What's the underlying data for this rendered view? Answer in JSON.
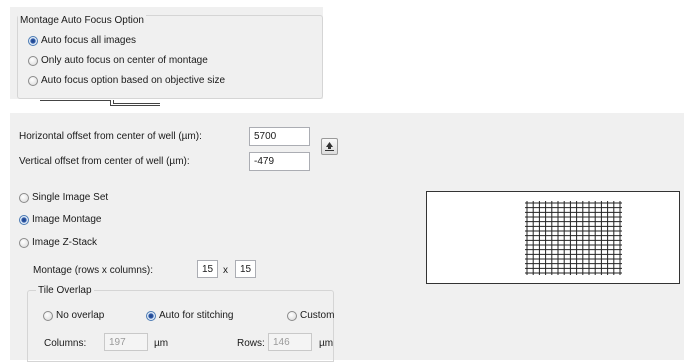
{
  "montage_af": {
    "title": "Montage Auto Focus Option",
    "options": [
      {
        "label": "Auto focus all images",
        "selected": true
      },
      {
        "label": "Only auto focus on center of montage",
        "selected": false
      },
      {
        "label": "Auto focus option based on objective size",
        "selected": false
      }
    ]
  },
  "offsets": {
    "horizontal_label": "Horizontal offset from center of well (µm):",
    "horizontal_value": "5700",
    "vertical_label": "Vertical offset from center of well (µm):",
    "vertical_value": "-479",
    "up_button_icon": "arrow-up-icon"
  },
  "acquisition": {
    "options": [
      {
        "label": "Single Image Set",
        "selected": false
      },
      {
        "label": "Image Montage",
        "selected": true
      },
      {
        "label": "Image Z-Stack",
        "selected": false
      }
    ]
  },
  "montage": {
    "label": "Montage (rows x columns):",
    "rows": "15",
    "separator": "x",
    "columns": "15"
  },
  "tile_overlap": {
    "title": "Tile Overlap",
    "options": [
      {
        "label": "No overlap",
        "selected": false
      },
      {
        "label": "Auto for stitching",
        "selected": true
      },
      {
        "label": "Custom",
        "selected": false
      }
    ],
    "columns_label": "Columns:",
    "columns_value": "197",
    "columns_unit": "µm",
    "rows_label": "Rows:",
    "rows_value": "146",
    "rows_unit": "µm"
  },
  "preview": {
    "grid_rows": 15,
    "grid_columns": 15
  }
}
